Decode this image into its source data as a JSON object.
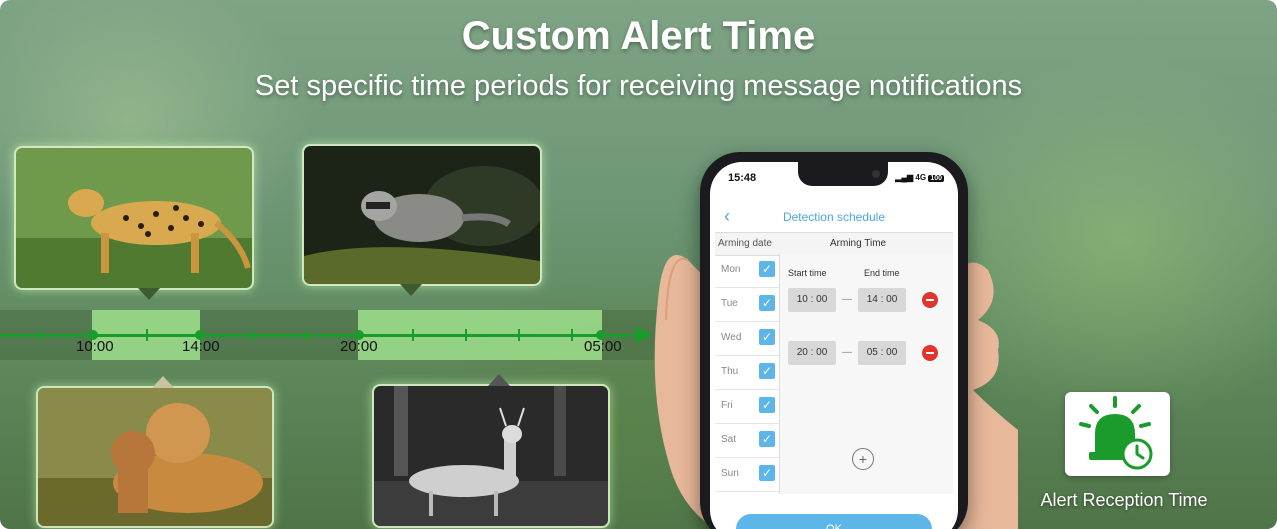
{
  "header": {
    "title": "Custom Alert Time",
    "subtitle": "Set specific time periods for receiving message notifications"
  },
  "timeline": {
    "labels": [
      "10:00",
      "14:00",
      "20:00",
      "05:00"
    ],
    "color": "#1a9b2b"
  },
  "photos": {
    "top_left": "cheetah",
    "top_middle": "raccoon",
    "bottom_left": "lions",
    "bottom_middle": "deer"
  },
  "phone": {
    "clock": "15:48",
    "network": "4G",
    "battery": "100",
    "nav_title": "Detection schedule",
    "arming_date_header": "Arming date",
    "arming_time_header": "Arming Time",
    "start_time_label": "Start time",
    "end_time_label": "End time",
    "days": [
      "Mon",
      "Tue",
      "Wed",
      "Thu",
      "Fri",
      "Sat",
      "Sun"
    ],
    "periods": [
      {
        "start": "10 : 00",
        "dash": "—",
        "end": "14 : 00"
      },
      {
        "start": "20 : 00",
        "dash": "—",
        "end": "05 : 00"
      }
    ],
    "add_symbol": "+",
    "ok_label": "OK",
    "accent": "#5db5e8"
  },
  "alert": {
    "label": "Alert Reception Time",
    "icon": "alarm-clock-icon",
    "icon_color": "#1a9b2b"
  }
}
